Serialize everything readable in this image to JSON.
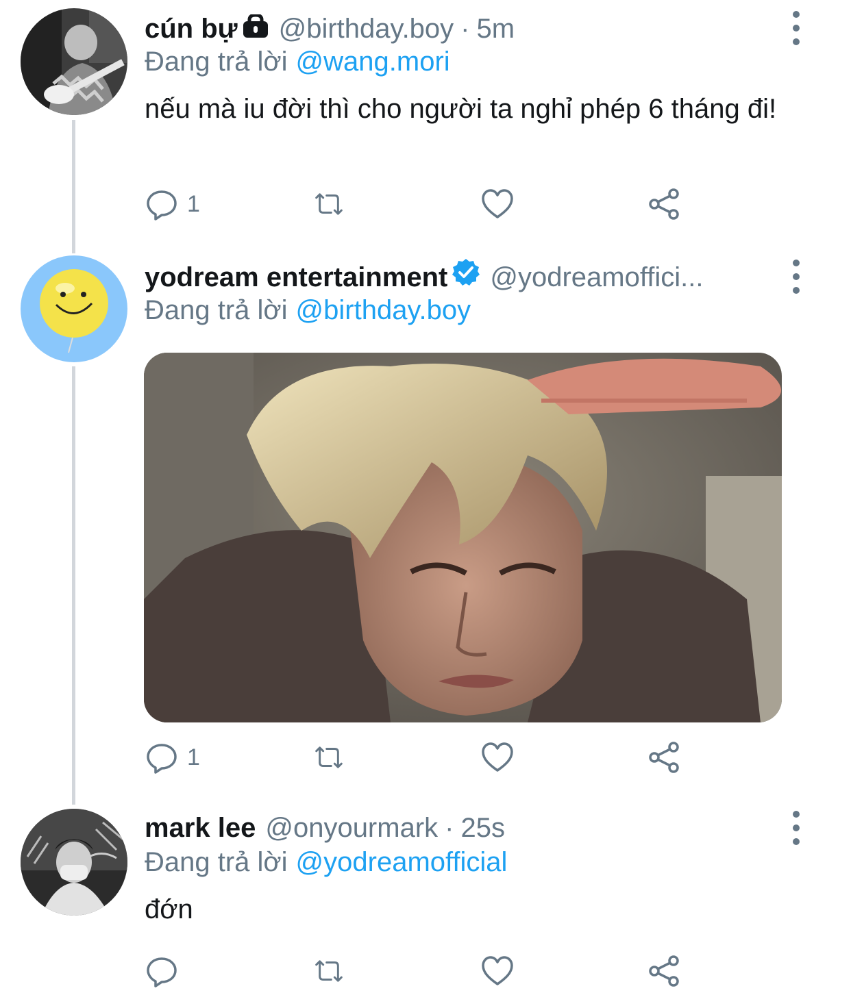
{
  "tweets": [
    {
      "display_name": "cún bự",
      "protected": true,
      "handle": "@birthday.boy",
      "time": "5m",
      "reply_prefix": "Đang trả lời",
      "reply_to": "@wang.mori",
      "text": "nếu mà iu đời thì cho người ta nghỉ phép 6 tháng đi!",
      "reply_count": "1"
    },
    {
      "display_name": "yodream entertainment",
      "verified": true,
      "handle": "@yodreamoffici...",
      "reply_prefix": "Đang trả lời",
      "reply_to": "@birthday.boy",
      "reply_count": "1"
    },
    {
      "display_name": "mark lee",
      "handle": "@onyourmark",
      "time": "25s",
      "reply_prefix": "Đang trả lời",
      "reply_to": "@yodreamofficial",
      "text": "đớn",
      "reply_count": ""
    }
  ],
  "separator": "·",
  "colors": {
    "link": "#1da1f2",
    "secondary_text": "#657786",
    "thread_line": "#d2d6db",
    "avatar_blue": "#8ac7fb",
    "smiley_yellow": "#f4e24a"
  },
  "icons": [
    "reply-icon",
    "retweet-icon",
    "like-icon",
    "share-icon",
    "more-options-icon",
    "lock-icon",
    "verified-badge-icon"
  ]
}
